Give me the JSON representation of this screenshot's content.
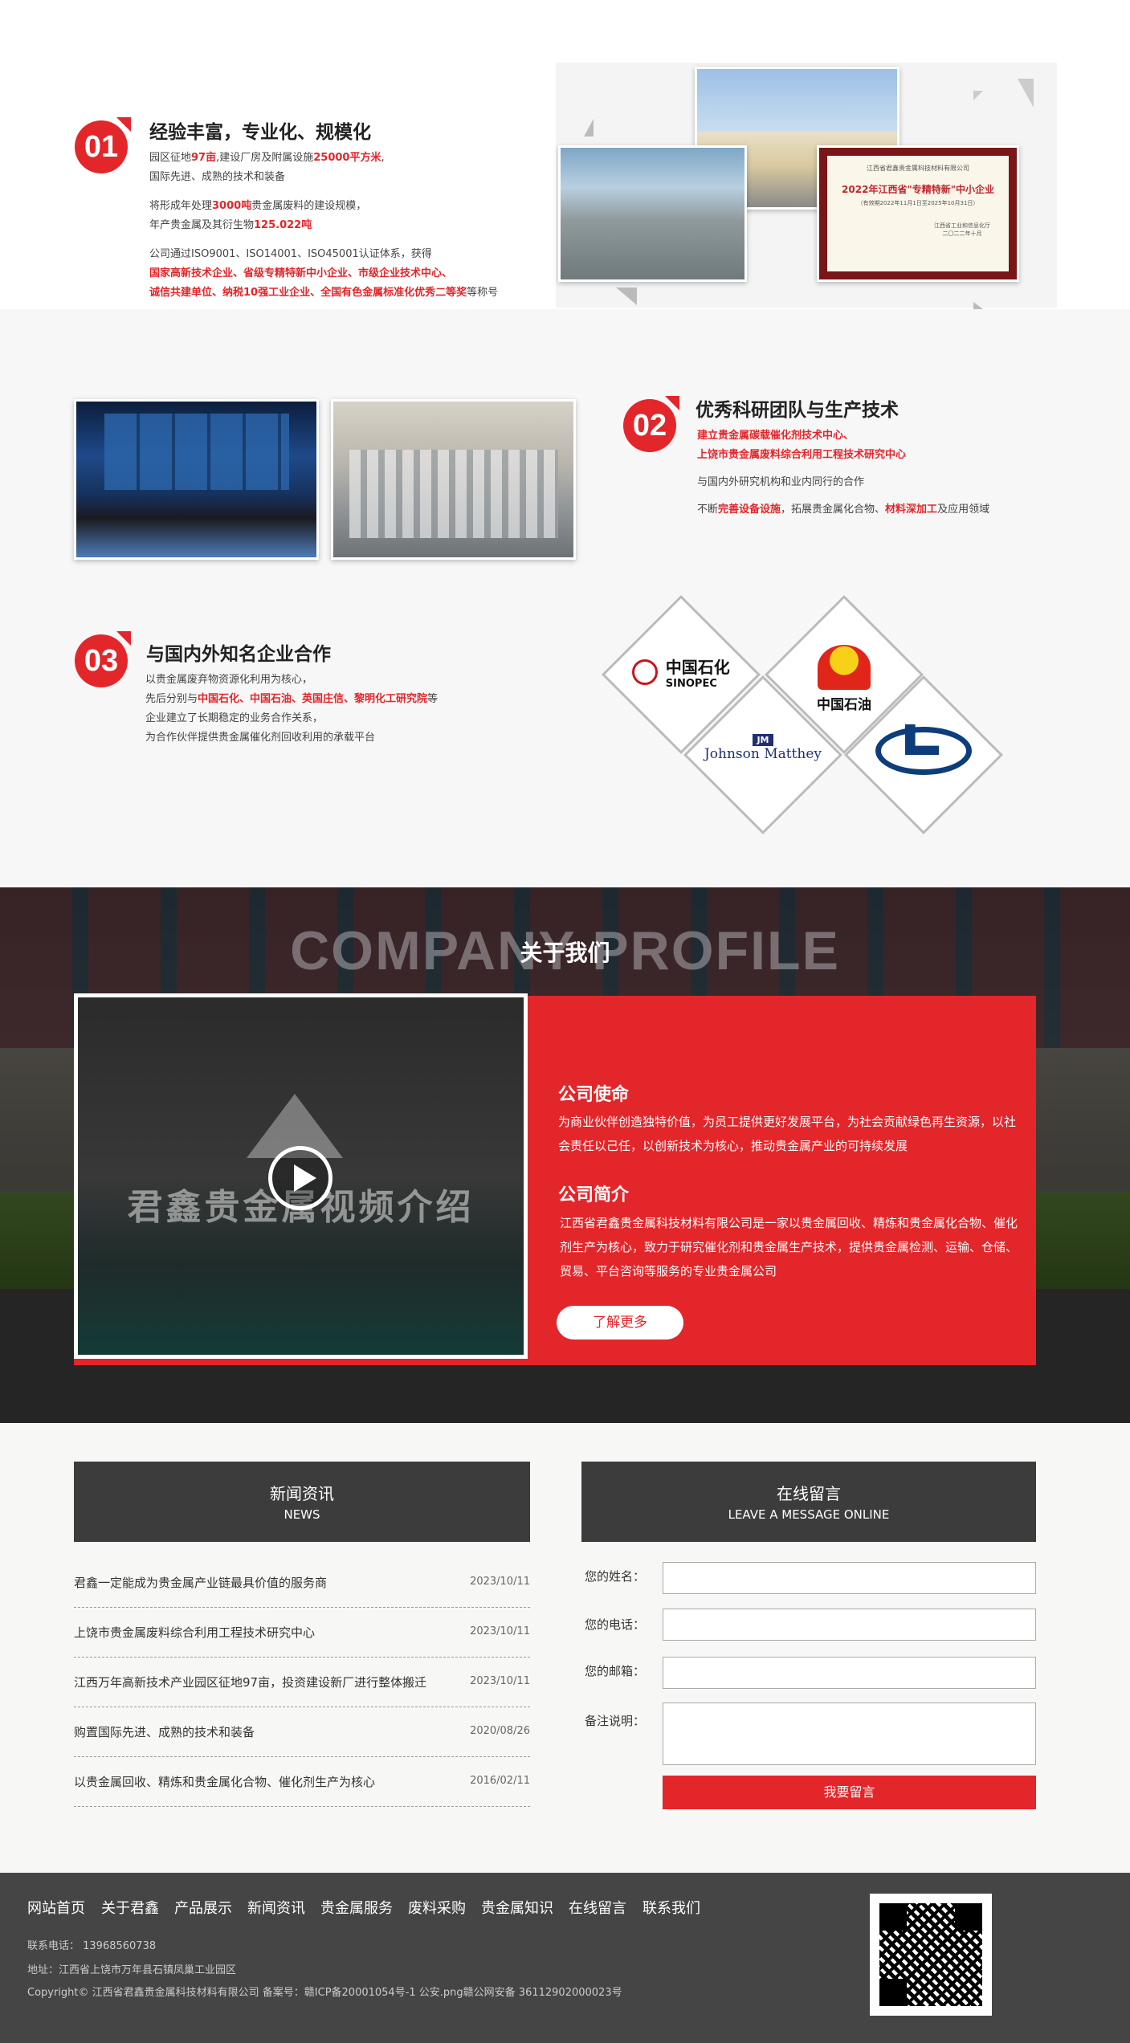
{
  "s1": {
    "num": "01",
    "title": "经验丰富，专业化、规模化",
    "p1a": "园区征地",
    "p1b": "97亩",
    "p1c": ",建设厂房及附属设施",
    "p1d": "25000平方米",
    "p1e": ",",
    "p1f": "国际先进、成熟的技术和装备",
    "p2a": "将形成年处理",
    "p2b": "3000吨",
    "p2c": "贵金属废料的建设规模，",
    "p2d": "年产贵金属及其衍生物",
    "p2e": "125.022吨",
    "p3a": "公司通过ISO9001、ISO14001、ISO45001认证体系，获得",
    "p3b": "国家高新技术企业、省级专精特新中小企业、市级企业技术中心、",
    "p3c": "诚信共建单位、纳税10强工业企业、全国有色金属标准化优秀二等奖",
    "p3d": "等称号",
    "cert_top": "江西省君鑫贵金属科技材料有限公司",
    "cert_main": "2022年江西省\"专精特新\"中小企业",
    "cert_sub": "（有效期2022年11月1日至2025年10月31日）",
    "cert_org": "江西省工业和信息化厅",
    "cert_date": "二〇二二年十月"
  },
  "s2": {
    "num": "02",
    "title": "优秀科研团队与生产技术",
    "l1": "建立贵金属碳载催化剂技术中心、",
    "l2": "上饶市贵金属废料综合利用工程技术研究中心",
    "l3": "与国内外研究机构和业内同行的合作",
    "l4a": "不断",
    "l4b": "完善设备设施",
    "l4c": "，拓展贵金属化合物、",
    "l4d": "材料深加工",
    "l4e": "及应用领域"
  },
  "s3a": {
    "num": "03",
    "title": "与国内外知名企业合作",
    "l1": "以贵金属废弃物资源化利用为核心，",
    "l2a": "先后分别与",
    "l2b": "中国石化、中国石油、英国庄信、黎明化工研究院",
    "l2c": "等",
    "l3": "企业建立了长期稳定的业务合作关系，",
    "l4": "为合作伙伴提供贵金属催化剂回收利用的承载平台",
    "logos": {
      "sinopec_cn": "中国石化",
      "sinopec_en": "SINOPEC",
      "cnpc": "中国石油",
      "jm": "Johnson Matthey",
      "jm_badge": "JM"
    }
  },
  "about": {
    "bg_title": "COMPANY PROFILE",
    "title": "关于我们",
    "video_text": "君鑫贵金属视频介绍",
    "mission_title": "公司使命",
    "mission_text": "为商业伙伴创造独特价值，为员工提供更好发展平台，为社会贡献绿色再生资源，以社会责任以己任，以创新技术为核心，推动贵金属产业的可持续发展",
    "intro_title": "公司简介",
    "intro_text": "江西省君鑫贵金属科技材料有限公司是一家以贵金属回收、精炼和贵金属化合物、催化剂生产为核心，致力于研究催化剂和贵金属生产技术，提供贵金属检测、运输、仓储、贸易、平台咨询等服务的专业贵金属公司",
    "more": "了解更多"
  },
  "news": {
    "title": "新闻资讯",
    "subtitle": "NEWS",
    "items": [
      {
        "t": "君鑫一定能成为贵金属产业链最具价值的服务商",
        "d": "2023/10/11"
      },
      {
        "t": "上饶市贵金属废料综合利用工程技术研究中心",
        "d": "2023/10/11"
      },
      {
        "t": "江西万年高新技术产业园区征地97亩，投资建设新厂进行整体搬迁",
        "d": "2023/10/11"
      },
      {
        "t": "购置国际先进、成熟的技术和装备",
        "d": "2020/08/26"
      },
      {
        "t": "以贵金属回收、精炼和贵金属化合物、催化剂生产为核心",
        "d": "2016/02/11"
      }
    ]
  },
  "msg": {
    "title": "在线留言",
    "subtitle": "LEAVE A MESSAGE ONLINE",
    "name": "您的姓名：",
    "phone": "您的电话：",
    "email": "您的邮箱：",
    "note": "备注说明：",
    "submit": "我要留言"
  },
  "footer": {
    "nav": [
      "网站首页",
      "关于君鑫",
      "产品展示",
      "新闻资讯",
      "贵金属服务",
      "废料采购",
      "贵金属知识",
      "在线留言",
      "联系我们"
    ],
    "phone": "联系电话： 13968560738",
    "addr": "地址：江西省上饶市万年县石镇凤巢工业园区",
    "copy": "Copyright© 江西省君鑫贵金属科技材料有限公司  备案号：赣ICP备20001054号-1  公安.png赣公网安备 36112902000023号"
  },
  "colors": {
    "accent": "#e3262a",
    "dark": "#454545"
  }
}
